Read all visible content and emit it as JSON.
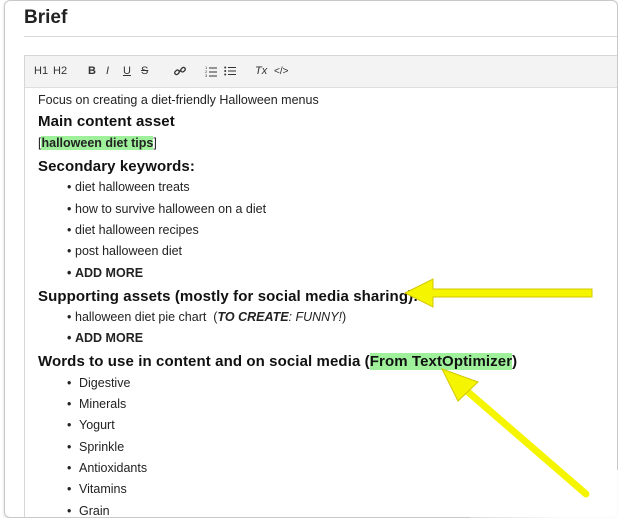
{
  "page": {
    "title": "Brief"
  },
  "toolbar": {
    "h1": "H1",
    "h2": "H2",
    "bold": "B",
    "italic": "I",
    "underline": "U",
    "strike": "S",
    "link_icon": "link-icon",
    "ordered_list_icon": "ordered-list-icon",
    "bullet_list_icon": "bullet-list-icon",
    "clear_format": "Tx",
    "code": "</>"
  },
  "content": {
    "intro": "Focus on creating a diet-friendly Halloween menus",
    "main_heading": "Main content asset",
    "main_asset_open": "[",
    "main_asset": "halloween diet tips",
    "main_asset_close": "]",
    "secondary_heading": "Secondary keywords:",
    "secondary_keywords": [
      "diet halloween treats",
      "how to survive halloween on a diet",
      "diet halloween recipes",
      "post halloween diet"
    ],
    "add_more": "ADD MORE",
    "supporting_heading": "Supporting assets (mostly for social media sharing):",
    "supporting_item": "halloween diet pie chart",
    "supporting_paren_open": "(",
    "supporting_to_create": "TO CREATE",
    "supporting_note": ": FUNNY!",
    "supporting_paren_close": ")",
    "words_heading_prefix": "Words to use in content and on social media (",
    "words_heading_highlight": "From TextOptimizer",
    "words_heading_suffix": ")",
    "words": [
      "Digestive",
      "Minerals",
      "Yogurt",
      "Sprinkle",
      "Antioxidants",
      "Vitamins",
      "Grain"
    ]
  },
  "colors": {
    "highlight": "#9ef09a",
    "arrow": "#f5f500"
  }
}
